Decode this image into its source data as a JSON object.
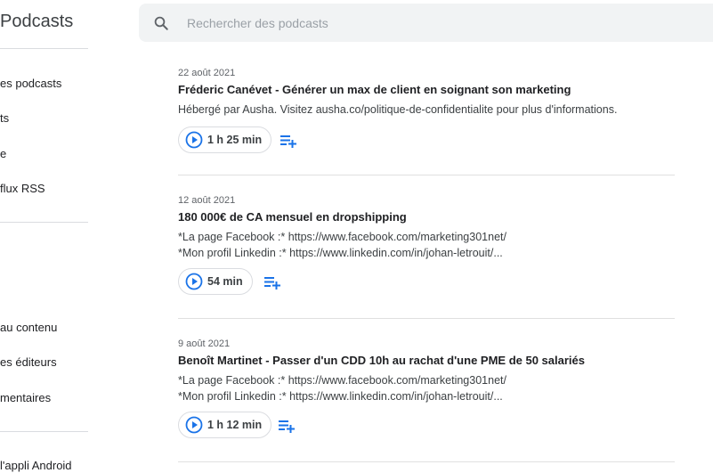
{
  "app": {
    "title": "Podcasts"
  },
  "sidebar": {
    "items": [
      {
        "label": "es podcasts"
      },
      {
        "label": "ts"
      },
      {
        "label": "e"
      },
      {
        "label": "flux RSS"
      },
      {
        "label": "au contenu"
      },
      {
        "label": "es éditeurs"
      },
      {
        "label": "mentaires"
      },
      {
        "label": "l'appli Android"
      }
    ]
  },
  "search": {
    "placeholder": "Rechercher des podcasts",
    "value": ""
  },
  "episodes": [
    {
      "date": "22 août 2021",
      "title": "Fréderic Canévet - Générer un max de client en soignant son marketing",
      "desc1": "Hébergé par Ausha. Visitez ausha.co/politique-de-confidentialite pour plus d'informations.",
      "desc2": "",
      "duration": "1 h 25 min"
    },
    {
      "date": "12 août 2021",
      "title": "180 000€ de CA mensuel en dropshipping",
      "desc1": "*La page Facebook :* https://www.facebook.com/marketing301net/",
      "desc2": "*Mon profil Linkedin :* https://www.linkedin.com/in/johan-letrouit/...",
      "duration": "54 min"
    },
    {
      "date": "9 août 2021",
      "title": "Benoît Martinet - Passer d'un CDD 10h au rachat d'une PME de 50 salariés",
      "desc1": "*La page Facebook :* https://www.facebook.com/marketing301net/",
      "desc2": "*Mon profil Linkedin :* https://www.linkedin.com/in/johan-letrouit/...",
      "duration": "1 h 12 min"
    }
  ],
  "colors": {
    "accent": "#1a73e8",
    "divider": "#dadce0",
    "search_bg": "#f1f3f4"
  }
}
